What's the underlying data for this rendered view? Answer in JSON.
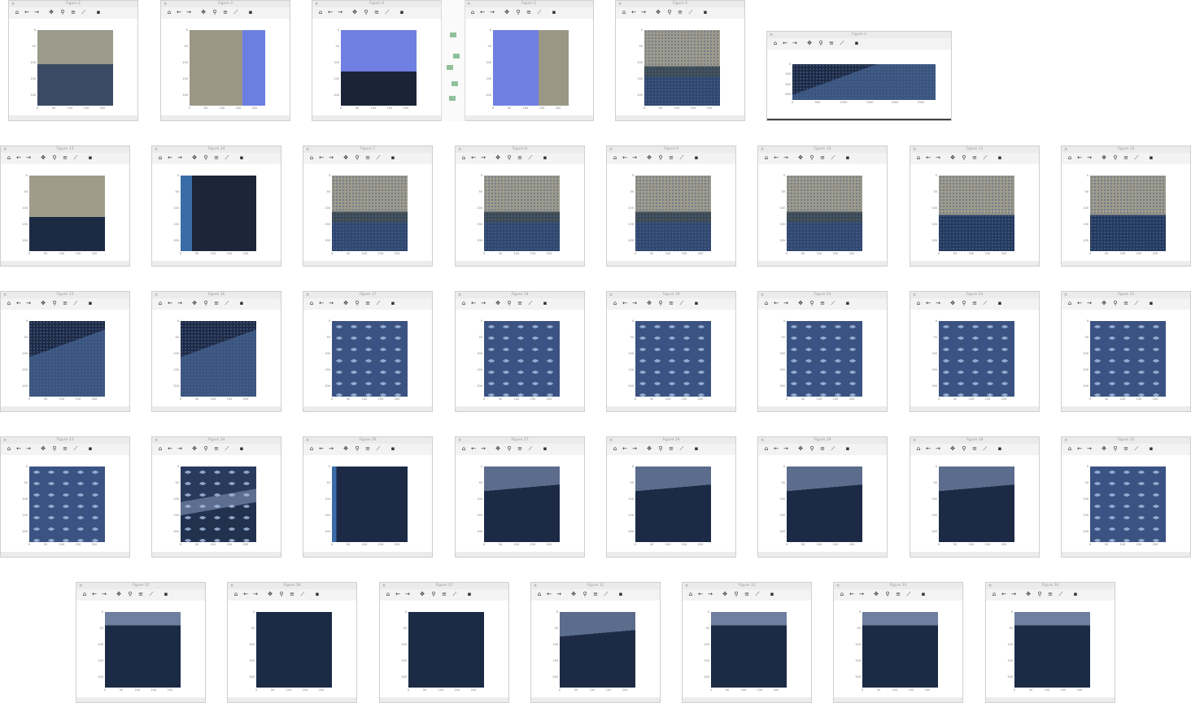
{
  "toolbar_icons": [
    "home-icon",
    "back-icon",
    "forward-icon",
    "pan-icon",
    "zoom-icon",
    "configure-icon",
    "axes-icon",
    "save-icon"
  ],
  "y_ticks": [
    "0",
    "50",
    "100",
    "150",
    "200"
  ],
  "x_ticks": [
    "0",
    "50",
    "100",
    "150",
    "200"
  ],
  "wide_figure": {
    "title": "Figure 1",
    "y_ticks": [
      "0",
      "200",
      "400",
      "600"
    ],
    "x_ticks": [
      "0",
      "500",
      "1000",
      "1500",
      "2000",
      "2500"
    ]
  },
  "windows": [
    {
      "title": "Figure 2",
      "img": "tank-rocks"
    },
    {
      "title": "Figure 3",
      "img": "tank-wall-blue"
    },
    {
      "title": "Figure 4",
      "img": "blue-panel"
    },
    {
      "title": "Figure 5",
      "img": "blue-panel-fish"
    },
    {
      "title": "Figure 6",
      "img": "fish-back"
    },
    {
      "title": "Figure 13",
      "img": "tank-wall"
    },
    {
      "title": "Figure 14",
      "img": "tank-edge-dark"
    },
    {
      "title": "Figure 7",
      "img": "fish-back"
    },
    {
      "title": "Figure 8",
      "img": "fish-back"
    },
    {
      "title": "Figure 9",
      "img": "fish-back"
    },
    {
      "title": "Figure 10",
      "img": "fish-back"
    },
    {
      "title": "Figure 11",
      "img": "fish-fin"
    },
    {
      "title": "Figure 12",
      "img": "fish-fin"
    },
    {
      "title": "Figure 15",
      "img": "fish-side"
    },
    {
      "title": "Figure 16",
      "img": "fish-side"
    },
    {
      "title": "Figure 17",
      "img": "spots"
    },
    {
      "title": "Figure 18",
      "img": "spots"
    },
    {
      "title": "Figure 19",
      "img": "spots"
    },
    {
      "title": "Figure 20",
      "img": "spots"
    },
    {
      "title": "Figure 21",
      "img": "spots"
    },
    {
      "title": "Figure 22",
      "img": "spots"
    },
    {
      "title": "Figure 23",
      "img": "spots"
    },
    {
      "title": "Figure 24",
      "img": "fish-jaw"
    },
    {
      "title": "Figure 26",
      "img": "tank-edge"
    },
    {
      "title": "Figure 27",
      "img": "dark-fin"
    },
    {
      "title": "Figure 28",
      "img": "dark-fin"
    },
    {
      "title": "Figure 29",
      "img": "dark-fin"
    },
    {
      "title": "Figure 30",
      "img": "dark-fin"
    },
    {
      "title": "Figure 25",
      "img": "spots"
    },
    {
      "title": "Figure 35",
      "img": "dark-top"
    },
    {
      "title": "Figure 36",
      "img": "dark"
    },
    {
      "title": "Figure 37",
      "img": "dark"
    },
    {
      "title": "Figure 31",
      "img": "dark-fin"
    },
    {
      "title": "Figure 32",
      "img": "dark-top"
    },
    {
      "title": "Figure 33",
      "img": "dark-top"
    },
    {
      "title": "Figure 34",
      "img": "dark-top"
    }
  ]
}
